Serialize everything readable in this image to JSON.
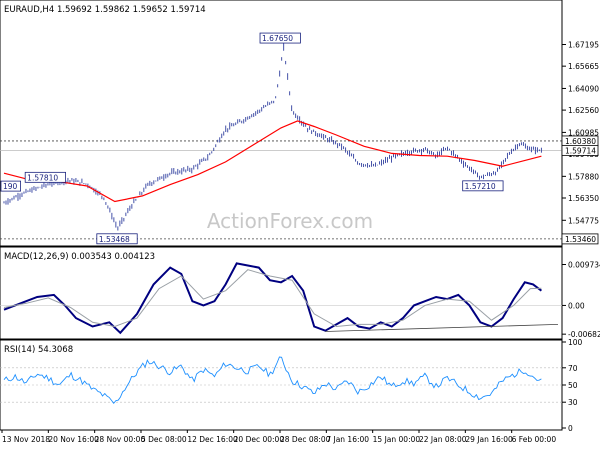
{
  "window": {
    "watermark": "ActionForex.com"
  },
  "colors": {
    "price_bars": "#2f3e9e",
    "moving_average": "#ff0000",
    "macd_main": "#000080",
    "macd_signal": "#9aa0a6",
    "rsi_line": "#1e90ff",
    "hline_dashed": "#444444",
    "watermark": "#c8c8c8",
    "grid": "#000000",
    "callout_border": "#1a237e",
    "price_tag_bg": "#ffffff"
  },
  "chart_data": [
    {
      "type": "candlestick",
      "header": "EURAUD,H4  1.59692  1.59862  1.59652  1.59714",
      "ylim": [
        1.531,
        1.6935
      ],
      "y_ticks": [
        "1.67195",
        "1.65665",
        "1.64090",
        "1.62560",
        "1.60985",
        "1.59455",
        "1.57880",
        "1.56350",
        "1.54775"
      ],
      "x_labels": [
        "13 Nov 2018",
        "20 Nov 16:00",
        "28 Nov 00:00",
        "5 Dec 08:00",
        "12 Dec 16:00",
        "20 Dec 00:00",
        "28 Dec 08:00",
        "7 Jan 16:00",
        "15 Jan 00:00",
        "22 Jan 08:00",
        "29 Jan 16:00",
        "6 Feb 00:00"
      ],
      "price_tags": [
        {
          "label": "1.60380",
          "value": 1.6038,
          "style": "dashed-line"
        },
        {
          "label": "1.59714",
          "value": 1.59714,
          "style": "current"
        },
        {
          "label": "1.53460",
          "value": 1.5346,
          "style": "dashed-line"
        }
      ],
      "annotations": [
        {
          "label": "1.67650",
          "value": 1.6765,
          "bar": 0.4986
        },
        {
          "label": "1.57810",
          "value": 1.5781,
          "bar": 0.0747
        },
        {
          "label": "1.53468",
          "value": 1.53468,
          "bar": 0.204
        },
        {
          "label": "1.57210",
          "value": 1.5721,
          "bar": 0.8644
        },
        {
          "label": "190",
          "value": 1.5719,
          "bar": 0.0
        }
      ],
      "close_path": [
        [
          0,
          1.56
        ],
        [
          0.03,
          1.566
        ],
        [
          0.06,
          1.5705
        ],
        [
          0.09,
          1.5745
        ],
        [
          0.12,
          1.576
        ],
        [
          0.15,
          1.5735
        ],
        [
          0.18,
          1.564
        ],
        [
          0.205,
          1.542
        ],
        [
          0.23,
          1.558
        ],
        [
          0.26,
          1.573
        ],
        [
          0.3,
          1.581
        ],
        [
          0.34,
          1.584
        ],
        [
          0.37,
          1.593
        ],
        [
          0.4,
          1.612
        ],
        [
          0.43,
          1.618
        ],
        [
          0.46,
          1.625
        ],
        [
          0.49,
          1.633
        ],
        [
          0.505,
          1.67
        ],
        [
          0.52,
          1.625
        ],
        [
          0.55,
          1.612
        ],
        [
          0.58,
          1.606
        ],
        [
          0.61,
          1.6
        ],
        [
          0.64,
          1.588
        ],
        [
          0.67,
          1.586
        ],
        [
          0.7,
          1.592
        ],
        [
          0.73,
          1.596
        ],
        [
          0.76,
          1.598
        ],
        [
          0.78,
          1.593
        ],
        [
          0.8,
          1.599
        ],
        [
          0.83,
          1.588
        ],
        [
          0.86,
          1.578
        ],
        [
          0.89,
          1.582
        ],
        [
          0.91,
          1.594
        ],
        [
          0.93,
          1.602
        ],
        [
          0.95,
          1.598
        ],
        [
          0.97,
          1.5971
        ]
      ],
      "ma_path": [
        [
          0,
          1.581
        ],
        [
          0.05,
          1.576
        ],
        [
          0.1,
          1.575
        ],
        [
          0.15,
          1.572
        ],
        [
          0.2,
          1.561
        ],
        [
          0.25,
          1.565
        ],
        [
          0.3,
          1.573
        ],
        [
          0.35,
          1.58
        ],
        [
          0.4,
          1.589
        ],
        [
          0.45,
          1.601
        ],
        [
          0.5,
          1.613
        ],
        [
          0.53,
          1.618
        ],
        [
          0.56,
          1.614
        ],
        [
          0.6,
          1.608
        ],
        [
          0.65,
          1.6
        ],
        [
          0.7,
          1.595
        ],
        [
          0.75,
          1.5935
        ],
        [
          0.8,
          1.593
        ],
        [
          0.85,
          1.59
        ],
        [
          0.9,
          1.586
        ],
        [
          0.95,
          1.591
        ],
        [
          0.97,
          1.593
        ]
      ]
    },
    {
      "type": "line",
      "header": "MACD(12,26,9)  0.003543  0.004123",
      "ylim": [
        -0.0075,
        0.0108
      ],
      "y_ticks": [
        {
          "label": "0.009734",
          "value": 0.009734
        },
        {
          "label": "0.00",
          "value": 0.0
        },
        {
          "label": "-0.006826",
          "value": -0.006826
        }
      ],
      "series": [
        {
          "role": "macd",
          "values": [
            [
              0,
              -0.001
            ],
            [
              0.03,
              0.0005
            ],
            [
              0.06,
              0.002
            ],
            [
              0.09,
              0.0025
            ],
            [
              0.11,
              0.0
            ],
            [
              0.13,
              -0.003
            ],
            [
              0.16,
              -0.005
            ],
            [
              0.19,
              -0.004
            ],
            [
              0.21,
              -0.0065
            ],
            [
              0.24,
              -0.002
            ],
            [
              0.27,
              0.005
            ],
            [
              0.3,
              0.009
            ],
            [
              0.32,
              0.0075
            ],
            [
              0.34,
              0.001
            ],
            [
              0.36,
              0.0
            ],
            [
              0.38,
              0.001
            ],
            [
              0.4,
              0.005
            ],
            [
              0.42,
              0.01
            ],
            [
              0.44,
              0.0095
            ],
            [
              0.46,
              0.009
            ],
            [
              0.48,
              0.006
            ],
            [
              0.5,
              0.0055
            ],
            [
              0.52,
              0.007
            ],
            [
              0.54,
              0.0035
            ],
            [
              0.56,
              -0.005
            ],
            [
              0.58,
              -0.006
            ],
            [
              0.6,
              -0.0045
            ],
            [
              0.62,
              -0.003
            ],
            [
              0.64,
              -0.005
            ],
            [
              0.66,
              -0.0055
            ],
            [
              0.68,
              -0.004
            ],
            [
              0.7,
              -0.005
            ],
            [
              0.72,
              -0.003
            ],
            [
              0.74,
              0.0
            ],
            [
              0.76,
              0.001
            ],
            [
              0.78,
              0.002
            ],
            [
              0.8,
              0.0015
            ],
            [
              0.82,
              0.0025
            ],
            [
              0.84,
              0.0
            ],
            [
              0.86,
              -0.004
            ],
            [
              0.88,
              -0.005
            ],
            [
              0.9,
              -0.003
            ],
            [
              0.92,
              0.0015
            ],
            [
              0.94,
              0.0055
            ],
            [
              0.955,
              0.005
            ],
            [
              0.97,
              0.0035
            ]
          ]
        },
        {
          "role": "signal",
          "values": [
            [
              0,
              -0.0005
            ],
            [
              0.04,
              0.0005
            ],
            [
              0.08,
              0.0018
            ],
            [
              0.12,
              -0.0005
            ],
            [
              0.16,
              -0.004
            ],
            [
              0.2,
              -0.005
            ],
            [
              0.24,
              -0.003
            ],
            [
              0.28,
              0.004
            ],
            [
              0.32,
              0.007
            ],
            [
              0.36,
              0.0015
            ],
            [
              0.4,
              0.0035
            ],
            [
              0.44,
              0.0085
            ],
            [
              0.48,
              0.007
            ],
            [
              0.52,
              0.006
            ],
            [
              0.56,
              -0.002
            ],
            [
              0.6,
              -0.005
            ],
            [
              0.64,
              -0.0045
            ],
            [
              0.68,
              -0.0045
            ],
            [
              0.72,
              -0.0035
            ],
            [
              0.76,
              0.0
            ],
            [
              0.8,
              0.0015
            ],
            [
              0.84,
              0.001
            ],
            [
              0.88,
              -0.0035
            ],
            [
              0.92,
              0.0
            ],
            [
              0.95,
              0.004
            ],
            [
              0.97,
              0.0041
            ]
          ]
        }
      ],
      "trendline": [
        [
          0.58,
          -0.0062
        ],
        [
          1.0,
          -0.0045
        ]
      ]
    },
    {
      "type": "line",
      "header": "RSI(14)  54.3068",
      "ylim": [
        0,
        100
      ],
      "y_ticks": [
        {
          "label": "100",
          "value": 100
        },
        {
          "label": "70",
          "value": 70
        },
        {
          "label": "50",
          "value": 50
        },
        {
          "label": "30",
          "value": 30
        },
        {
          "label": "0",
          "value": 0
        }
      ],
      "series": [
        {
          "role": "rsi",
          "values": [
            [
              0,
              55
            ],
            [
              0.02,
              60
            ],
            [
              0.04,
              52
            ],
            [
              0.06,
              63
            ],
            [
              0.08,
              58
            ],
            [
              0.1,
              50
            ],
            [
              0.12,
              62
            ],
            [
              0.14,
              55
            ],
            [
              0.16,
              45
            ],
            [
              0.18,
              38
            ],
            [
              0.2,
              28
            ],
            [
              0.22,
              48
            ],
            [
              0.24,
              65
            ],
            [
              0.26,
              78
            ],
            [
              0.28,
              72
            ],
            [
              0.3,
              65
            ],
            [
              0.32,
              72
            ],
            [
              0.34,
              55
            ],
            [
              0.36,
              68
            ],
            [
              0.38,
              60
            ],
            [
              0.4,
              75
            ],
            [
              0.42,
              70
            ],
            [
              0.44,
              66
            ],
            [
              0.46,
              72
            ],
            [
              0.48,
              62
            ],
            [
              0.5,
              82
            ],
            [
              0.52,
              55
            ],
            [
              0.54,
              48
            ],
            [
              0.56,
              40
            ],
            [
              0.58,
              52
            ],
            [
              0.6,
              45
            ],
            [
              0.62,
              55
            ],
            [
              0.64,
              42
            ],
            [
              0.66,
              50
            ],
            [
              0.68,
              60
            ],
            [
              0.7,
              48
            ],
            [
              0.72,
              55
            ],
            [
              0.74,
              52
            ],
            [
              0.76,
              60
            ],
            [
              0.78,
              48
            ],
            [
              0.8,
              58
            ],
            [
              0.82,
              50
            ],
            [
              0.84,
              42
            ],
            [
              0.86,
              35
            ],
            [
              0.88,
              40
            ],
            [
              0.9,
              55
            ],
            [
              0.92,
              62
            ],
            [
              0.94,
              68
            ],
            [
              0.955,
              60
            ],
            [
              0.97,
              54
            ]
          ]
        }
      ]
    }
  ]
}
